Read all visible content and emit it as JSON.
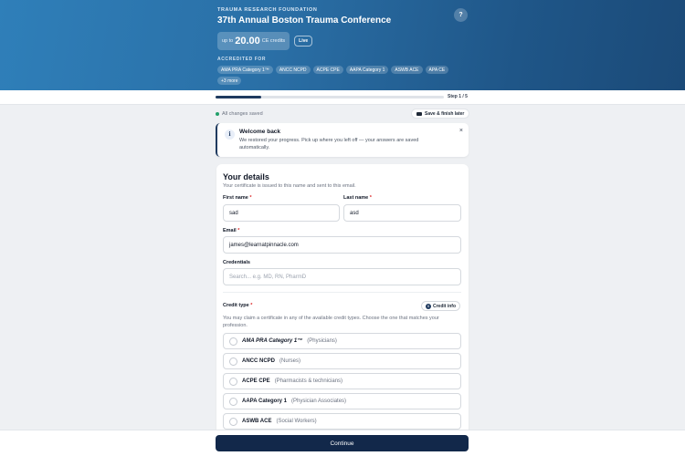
{
  "header": {
    "org": "TRAUMA RESEARCH FOUNDATION",
    "title": "37th Annual Boston Trauma Conference",
    "credits_prefix": "up to",
    "credits_value": "20.00",
    "credits_suffix": "CE credits",
    "live_label": "Live",
    "accredited_label": "ACCREDITED FOR",
    "chips": [
      "AMA PRA Category 1™",
      "ANCC NCPD",
      "ACPE CPE",
      "AAPA Category 1",
      "ASWB ACE",
      "APA CE",
      "+3 more"
    ],
    "help_label": "?"
  },
  "progress": {
    "fraction": 0.2,
    "step_label": "Step 1 / 5"
  },
  "status": {
    "saved_text": "All changes saved",
    "save_button": "Save & finish later"
  },
  "alert": {
    "title": "Welcome back",
    "body": "We restored your progress. Pick up where you left off — your answers are saved automatically.",
    "close": "×",
    "icon_glyph": "i"
  },
  "form": {
    "title": "Your details",
    "subtitle": "Your certificate is issued to this name and sent to this email.",
    "first_name_label": "First name",
    "first_name_value": "sad",
    "last_name_label": "Last name",
    "last_name_value": "asd",
    "email_label": "Email",
    "email_value": "james@learnatpinnacle.com",
    "credentials_label": "Credentials",
    "credentials_placeholder": "Search... e.g. MD, RN, PharmD",
    "required_mark": "*",
    "credit_type_label": "Credit type",
    "credit_info_button": "Credit info",
    "credit_info_glyph": "i",
    "credit_help": "You may claim a certificate in any of the available credit types. Choose the one that matches your profession.",
    "options": [
      {
        "name": "AMA PRA Category 1™",
        "audience": "(Physicians)"
      },
      {
        "name": "ANCC NCPD",
        "audience": "(Nurses)"
      },
      {
        "name": "ACPE CPE",
        "audience": "(Pharmacists & technicians)"
      },
      {
        "name": "AAPA Category 1",
        "audience": "(Physician Associates)"
      },
      {
        "name": "ASWB ACE",
        "audience": "(Social Workers)"
      }
    ]
  },
  "footer": {
    "continue_label": "Continue"
  },
  "colors": {
    "accent": "#12284a",
    "hero": "#2a6fa6",
    "success": "#22a06b",
    "required": "#dc2626"
  }
}
